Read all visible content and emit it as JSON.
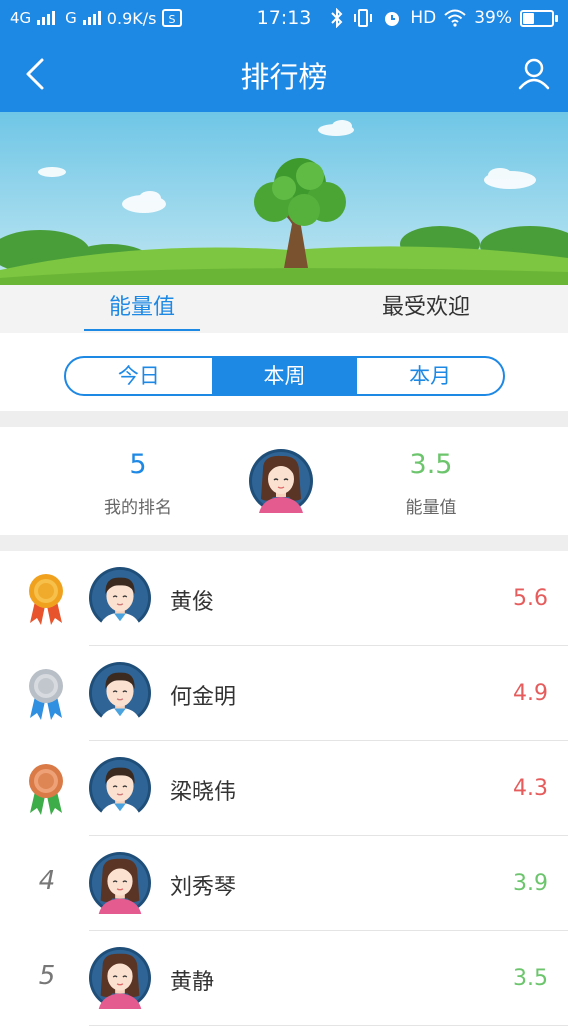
{
  "status_bar": {
    "network1": "4G",
    "network2": "G",
    "speed": "0.9K/s",
    "time": "17:13",
    "hd": "HD",
    "battery": "39%",
    "battery_level": 0.39
  },
  "header": {
    "title": "排行榜"
  },
  "category_tabs": [
    {
      "label": "能量值",
      "active": true
    },
    {
      "label": "最受欢迎",
      "active": false
    }
  ],
  "period_tabs": [
    {
      "label": "今日",
      "active": false
    },
    {
      "label": "本周",
      "active": true
    },
    {
      "label": "本月",
      "active": false
    }
  ],
  "my_rank": {
    "rank": "5",
    "rank_label": "我的排名",
    "energy": "3.5",
    "energy_label": "能量值"
  },
  "colors": {
    "primary": "#1e88e5",
    "score_top": "#e65c5c",
    "score_normal": "#6cc56c"
  },
  "ranking": [
    {
      "rank": "1",
      "medal": "gold-medal-icon",
      "name": "黄俊",
      "score": "5.6",
      "gender": "male"
    },
    {
      "rank": "2",
      "medal": "silver-medal-icon",
      "name": "何金明",
      "score": "4.9",
      "gender": "male"
    },
    {
      "rank": "3",
      "medal": "bronze-medal-icon",
      "name": "梁晓伟",
      "score": "4.3",
      "gender": "male"
    },
    {
      "rank": "4",
      "medal": "",
      "name": "刘秀琴",
      "score": "3.9",
      "gender": "female"
    },
    {
      "rank": "5",
      "medal": "",
      "name": "黄静",
      "score": "3.5",
      "gender": "female"
    }
  ]
}
